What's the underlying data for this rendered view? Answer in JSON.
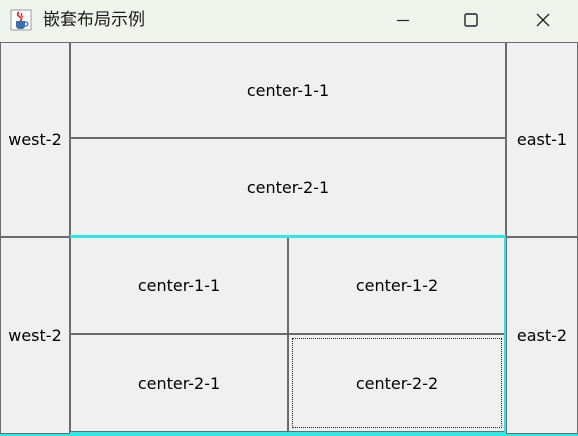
{
  "window": {
    "title": "嵌套布局示例"
  },
  "top_panel": {
    "west_label": "west-2",
    "east_label": "east-1",
    "center_1_1": "center-1-1",
    "center_2_1": "center-2-1"
  },
  "bottom_panel": {
    "west_label": "west-2",
    "east_label": "east-2",
    "center_1_1": "center-1-1",
    "center_1_2": "center-1-2",
    "center_2_1": "center-2-1",
    "center_2_2": "center-2-2"
  },
  "colors": {
    "titlebar_bg": "#eff4ec",
    "button_bg": "#f0f0f0",
    "border": "#6b6b6b",
    "focus_cyan": "#33e6e6"
  },
  "icons": {
    "app": "java-coffee-cup-icon",
    "minimize": "minimize-icon",
    "maximize": "maximize-icon",
    "close": "close-icon"
  }
}
